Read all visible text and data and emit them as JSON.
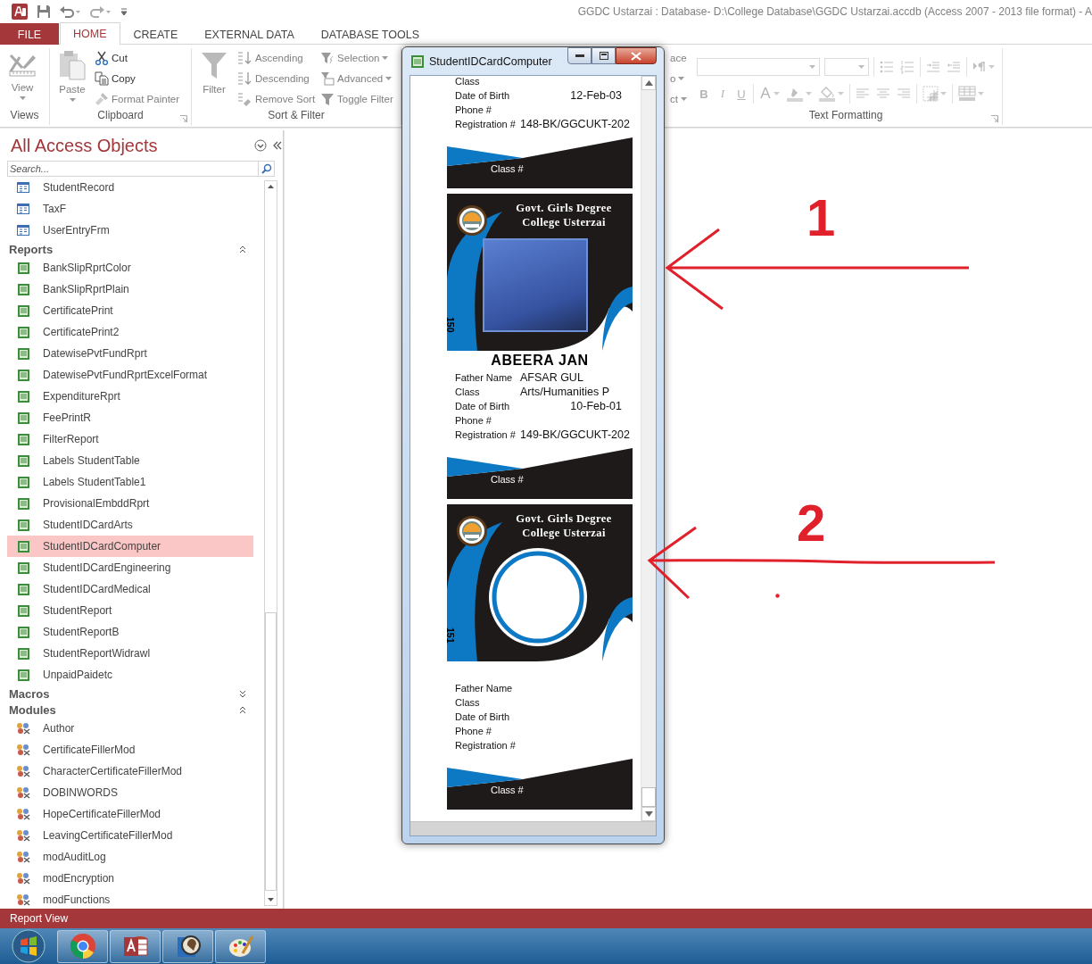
{
  "window": {
    "title": "GGDC Ustarzai : Database- D:\\College Database\\GGDC Ustarzai.accdb (Access 2007 - 2013 file format) - A"
  },
  "tabs": [
    {
      "label": "FILE",
      "kind": "file",
      "selected": false
    },
    {
      "label": "HOME",
      "kind": "tab",
      "selected": true
    },
    {
      "label": "CREATE",
      "kind": "tab",
      "selected": false
    },
    {
      "label": "EXTERNAL DATA",
      "kind": "tab",
      "selected": false
    },
    {
      "label": "DATABASE TOOLS",
      "kind": "tab",
      "selected": false
    }
  ],
  "ribbon": {
    "groups": [
      {
        "kind": "views",
        "label": "Views",
        "buttons": [
          {
            "label": "View",
            "kind": "view",
            "dropdown": true,
            "disabled": true
          }
        ]
      },
      {
        "kind": "clipboard",
        "label": "Clipboard",
        "buttons": [
          {
            "label": "Paste",
            "kind": "paste",
            "dropdown": true,
            "disabled": true
          },
          {
            "label": "Cut",
            "kind": "cut",
            "dropdown": false,
            "disabled": false
          },
          {
            "label": "Copy",
            "kind": "copy",
            "dropdown": false,
            "disabled": false
          },
          {
            "label": "Format Painter",
            "kind": "painter",
            "dropdown": false,
            "disabled": true
          }
        ]
      },
      {
        "kind": "sort",
        "label": "Sort & Filter",
        "buttons": [
          {
            "label": "Filter",
            "kind": "filter",
            "dropdown": false,
            "disabled": true
          },
          {
            "label": "Ascending",
            "kind": "ascending",
            "dropdown": false,
            "disabled": true
          },
          {
            "label": "Descending",
            "kind": "descending",
            "dropdown": false,
            "disabled": true
          },
          {
            "label": "Remove Sort",
            "kind": "remove-sort",
            "dropdown": false,
            "disabled": true
          },
          {
            "label": "Selection",
            "kind": "selection",
            "dropdown": true,
            "disabled": true
          },
          {
            "label": "Advanced",
            "kind": "advanced",
            "dropdown": true,
            "disabled": true
          },
          {
            "label": "Toggle Filter",
            "kind": "toggle-filter",
            "dropdown": false,
            "disabled": true
          }
        ]
      },
      {
        "kind": "find",
        "buttons": [
          {
            "label": "ace",
            "dropdown": false,
            "disabled": true
          },
          {
            "label": "o",
            "dropdown": true,
            "disabled": true
          },
          {
            "label": "ct",
            "dropdown": true,
            "disabled": true
          }
        ]
      },
      {
        "kind": "text_formatting",
        "label": "Text Formatting",
        "buttons": [
          {
            "kind": "font-combo",
            "dropdown": true,
            "disabled": true
          },
          {
            "kind": "size-combo",
            "dropdown": true,
            "disabled": true
          },
          {
            "kind": "bullets",
            "dropdown": false,
            "disabled": true
          },
          {
            "kind": "numbering",
            "dropdown": false,
            "disabled": true
          },
          {
            "kind": "indent",
            "dropdown": false,
            "disabled": true
          },
          {
            "kind": "outdent",
            "dropdown": false,
            "disabled": true
          },
          {
            "kind": "direction",
            "dropdown": true,
            "disabled": true
          },
          {
            "kind": "bold",
            "label": "B",
            "dropdown": false,
            "disabled": true
          },
          {
            "kind": "italic",
            "label": "I",
            "dropdown": false,
            "disabled": true
          },
          {
            "kind": "underline",
            "label": "U",
            "dropdown": false,
            "disabled": true
          },
          {
            "kind": "font-color",
            "label": "A",
            "dropdown": true,
            "disabled": true
          },
          {
            "kind": "highlight",
            "dropdown": true,
            "disabled": true
          },
          {
            "kind": "fill",
            "dropdown": true,
            "disabled": true
          },
          {
            "kind": "align-left",
            "dropdown": false,
            "disabled": true
          },
          {
            "kind": "align-center",
            "dropdown": false,
            "disabled": true
          },
          {
            "kind": "align-right",
            "dropdown": false,
            "disabled": true
          },
          {
            "kind": "gridlines",
            "dropdown": true,
            "disabled": true
          },
          {
            "kind": "alt-row",
            "dropdown": true,
            "disabled": true
          }
        ]
      }
    ]
  },
  "navigation": {
    "title": "All Access Objects",
    "search": {
      "placeholder": "Search..."
    },
    "sections": [
      {
        "kind": "form",
        "items": [
          {
            "label": "StudentRecord",
            "selected": false
          },
          {
            "label": "TaxF",
            "selected": false
          },
          {
            "label": "UserEntryFrm",
            "selected": false
          }
        ]
      },
      {
        "kind": "report",
        "title": "Reports",
        "expanded": true,
        "items": [
          {
            "label": "BankSlipRprtColor",
            "selected": false
          },
          {
            "label": "BankSlipRprtPlain",
            "selected": false
          },
          {
            "label": "CertificatePrint",
            "selected": false
          },
          {
            "label": "CertificatePrint2",
            "selected": false
          },
          {
            "label": "DatewisePvtFundRprt",
            "selected": false
          },
          {
            "label": "DatewisePvtFundRprtExcelFormat",
            "selected": false
          },
          {
            "label": "ExpenditureRprt",
            "selected": false
          },
          {
            "label": "FeePrintR",
            "selected": false
          },
          {
            "label": "FilterReport",
            "selected": false
          },
          {
            "label": "Labels StudentTable",
            "selected": false
          },
          {
            "label": "Labels StudentTable1",
            "selected": false
          },
          {
            "label": "ProvisionalEmbddRprt",
            "selected": false
          },
          {
            "label": "StudentIDCardArts",
            "selected": false
          },
          {
            "label": "StudentIDCardComputer",
            "selected": true
          },
          {
            "label": "StudentIDCardEngineering",
            "selected": false
          },
          {
            "label": "StudentIDCardMedical",
            "selected": false
          },
          {
            "label": "StudentReport",
            "selected": false
          },
          {
            "label": "StudentReportB",
            "selected": false
          },
          {
            "label": "StudentReportWidrawl",
            "selected": false
          },
          {
            "label": "UnpaidPaidetc",
            "selected": false
          }
        ]
      },
      {
        "title": "Macros",
        "expanded": false
      },
      {
        "kind": "module",
        "title": "Modules",
        "expanded": true,
        "items": [
          {
            "label": "Author",
            "selected": false
          },
          {
            "label": "CertificateFillerMod",
            "selected": false
          },
          {
            "label": "CharacterCertificateFillerMod",
            "selected": false
          },
          {
            "label": "DOBINWORDS",
            "selected": false
          },
          {
            "label": "HopeCertificateFillerMod",
            "selected": false
          },
          {
            "label": "LeavingCertificateFillerMod",
            "selected": false
          },
          {
            "label": "modAuditLog",
            "selected": false
          },
          {
            "label": "modEncryption",
            "selected": false
          },
          {
            "label": "modFunctions",
            "selected": false
          }
        ]
      }
    ]
  },
  "report_window": {
    "title": "StudentIDCardComputer",
    "cards": [
      {
        "fields": [
          {
            "kind": "class",
            "label": "Class"
          },
          {
            "kind": "dob",
            "label": "Date of Birth",
            "value": "12-Feb-03"
          },
          {
            "kind": "phone",
            "label": "Phone #"
          },
          {
            "kind": "reg",
            "label": "Registration #",
            "value": "148-BK/GGCUKT-202"
          }
        ],
        "footer": "Class #"
      },
      {
        "header": [
          "Govt. Girls Degree",
          "College Usterzai"
        ],
        "photo": {
          "kind": "photo"
        },
        "serial": "150",
        "name": "ABEERA JAN",
        "fields": [
          {
            "kind": "father",
            "label": "Father Name",
            "value": "AFSAR GUL"
          },
          {
            "kind": "class",
            "label": "Class",
            "value": "Arts/Humanities P"
          },
          {
            "kind": "dob",
            "label": "Date of Birth",
            "value": "10-Feb-01"
          },
          {
            "kind": "phone",
            "label": "Phone #"
          },
          {
            "kind": "reg",
            "label": "Registration #",
            "value": "149-BK/GGCUKT-202"
          }
        ],
        "footer": "Class #"
      },
      {
        "header": [
          "Govt. Girls Degree",
          "College Usterzai"
        ],
        "photo": {
          "kind": "empty"
        },
        "serial": "151",
        "fields": [
          {
            "kind": "father",
            "label": "Father Name"
          },
          {
            "kind": "class",
            "label": "Class"
          },
          {
            "kind": "dob",
            "label": "Date of Birth"
          },
          {
            "kind": "phone",
            "label": "Phone #"
          },
          {
            "kind": "reg",
            "label": "Registration #"
          }
        ],
        "footer": "Class #"
      }
    ]
  },
  "annotations": [
    {
      "label": "1"
    },
    {
      "label": "2"
    }
  ],
  "status_bar": {
    "text": "Report View"
  },
  "taskbar": {
    "apps": [
      {
        "kind": "chrome"
      },
      {
        "kind": "access"
      },
      {
        "kind": "media"
      },
      {
        "kind": "paint"
      }
    ]
  }
}
